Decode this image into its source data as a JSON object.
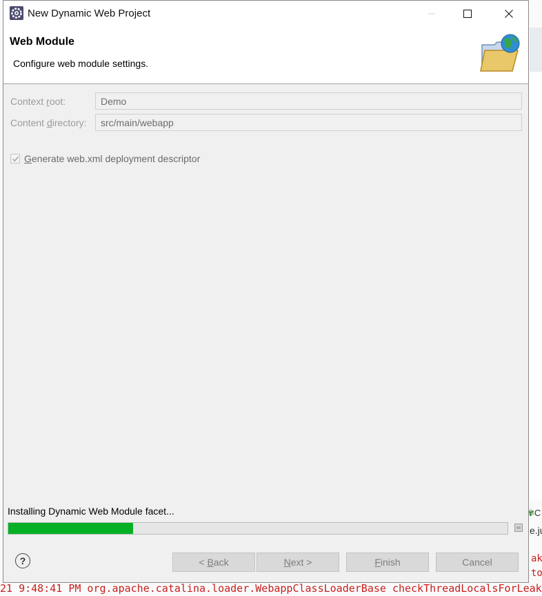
{
  "window": {
    "title": "New Dynamic Web Project",
    "app_icon": "eclipse-gear-icon"
  },
  "header": {
    "title": "Web Module",
    "description": "Configure web module settings.",
    "banner_icon": "folder-globe-icon"
  },
  "form": {
    "context_root": {
      "label_pre": "Context ",
      "label_mnemonic": "r",
      "label_post": "oot:",
      "value": "Demo"
    },
    "content_directory": {
      "label_pre": "Content ",
      "label_mnemonic": "d",
      "label_post": "irectory:",
      "value": "src/main/webapp"
    },
    "generate_web_xml": {
      "label_mnemonic": "G",
      "label_rest": "enerate web.xml deployment descriptor",
      "checked": true,
      "enabled": false
    }
  },
  "progress": {
    "label": "Installing Dynamic Web Module facet...",
    "percent": 25
  },
  "buttons": {
    "back": {
      "pre": "< ",
      "mnemonic": "B",
      "post": "ack"
    },
    "next": {
      "mnemonic": "N",
      "post": "ext >"
    },
    "finish": {
      "mnemonic": "F",
      "post": "inish"
    },
    "cancel": "Cancel"
  },
  "background": {
    "tab_fragment": "C",
    "tab_fragment_2": "e.ju",
    "console_fragment": "21 9:48:41 PM org.apache.catalina.loader.WebappClassLoaderBase checkThreadLocalsForLeaks",
    "console_side_1": "aks",
    "console_side_2": "to"
  },
  "colors": {
    "progress_fill": "#06b025",
    "console_error": "#c81e1e"
  }
}
